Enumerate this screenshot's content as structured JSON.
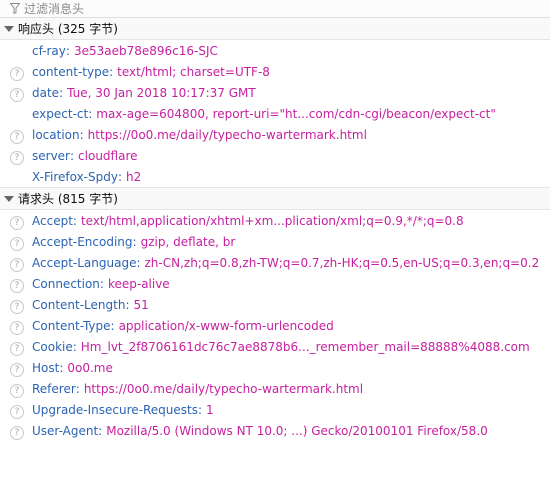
{
  "filter": {
    "placeholder": "过滤消息头"
  },
  "response": {
    "title": "响应头 (325 字节)",
    "rows": [
      {
        "name": "cf-ray",
        "value": "3e53aeb78e896c16-SJC",
        "help": false
      },
      {
        "name": "content-type",
        "value": "text/html; charset=UTF-8",
        "help": true
      },
      {
        "name": "date",
        "value": "Tue, 30 Jan 2018 10:17:37 GMT",
        "help": true
      },
      {
        "name": "expect-ct",
        "value": "max-age=604800, report-uri=\"ht...com/cdn-cgi/beacon/expect-ct\"",
        "help": false
      },
      {
        "name": "location",
        "value": "https://0o0.me/daily/typecho-wartermark.html",
        "help": true
      },
      {
        "name": "server",
        "value": "cloudflare",
        "help": true
      },
      {
        "name": "X-Firefox-Spdy",
        "value": "h2",
        "help": false
      }
    ]
  },
  "request": {
    "title": "请求头 (815 字节)",
    "rows": [
      {
        "name": "Accept",
        "value": "text/html,application/xhtml+xm...plication/xml;q=0.9,*/*;q=0.8",
        "help": true
      },
      {
        "name": "Accept-Encoding",
        "value": "gzip, deflate, br",
        "help": true
      },
      {
        "name": "Accept-Language",
        "value": "zh-CN,zh;q=0.8,zh-TW;q=0.7,zh-HK;q=0.5,en-US;q=0.3,en;q=0.2",
        "help": true
      },
      {
        "name": "Connection",
        "value": "keep-alive",
        "help": true
      },
      {
        "name": "Content-Length",
        "value": "51",
        "help": true
      },
      {
        "name": "Content-Type",
        "value": "application/x-www-form-urlencoded",
        "help": true
      },
      {
        "name": "Cookie",
        "value": "Hm_lvt_2f8706161dc76c7ae8878b6..._remember_mail=88888%4088.com",
        "help": true
      },
      {
        "name": "Host",
        "value": "0o0.me",
        "help": true
      },
      {
        "name": "Referer",
        "value": "https://0o0.me/daily/typecho-wartermark.html",
        "help": true
      },
      {
        "name": "Upgrade-Insecure-Requests",
        "value": "1",
        "help": true
      },
      {
        "name": "User-Agent",
        "value": "Mozilla/5.0 (Windows NT 10.0; ...) Gecko/20100101 Firefox/58.0",
        "help": true
      }
    ]
  },
  "colors": {
    "name": "#2b64b3",
    "value": "#c6219f"
  },
  "icons": {
    "filter": "filter-icon",
    "help": "help-icon",
    "twisty": "twisty-expanded-icon"
  }
}
